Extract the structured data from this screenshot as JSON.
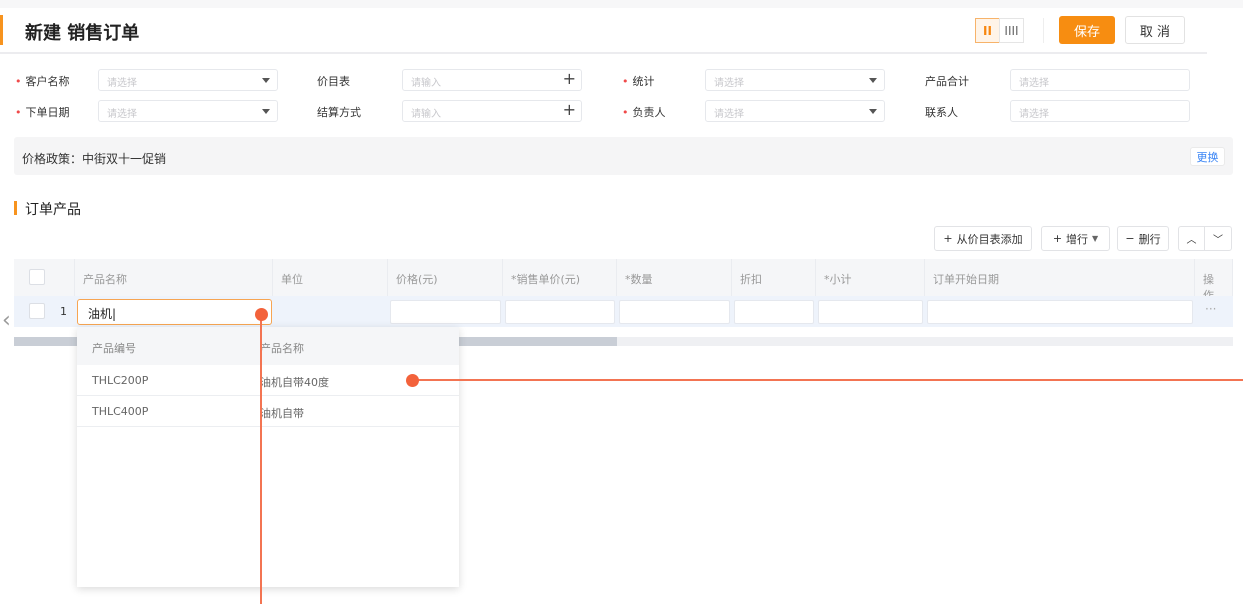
{
  "header": {
    "title": "新建 销售订单",
    "save_label": "保存",
    "cancel_label": "取 消",
    "view_toggle": [
      "II",
      "IIII"
    ]
  },
  "form": {
    "fields": [
      {
        "label": "客户名称",
        "required": true,
        "placeholder": "请选择",
        "type": "select"
      },
      {
        "label": "价目表",
        "required": false,
        "placeholder": "请输入",
        "type": "add"
      },
      {
        "label": "统计",
        "required": true,
        "placeholder": "请选择",
        "type": "select"
      },
      {
        "label": "产品合计",
        "required": false,
        "placeholder": "请选择",
        "type": "text"
      },
      {
        "label": "下单日期",
        "required": true,
        "placeholder": "请选择",
        "type": "select"
      },
      {
        "label": "结算方式",
        "required": false,
        "placeholder": "请输入",
        "type": "add"
      },
      {
        "label": "负责人",
        "required": true,
        "placeholder": "请选择",
        "type": "select"
      },
      {
        "label": "联系人",
        "required": false,
        "placeholder": "请选择",
        "type": "text"
      }
    ]
  },
  "policy": {
    "text": "价格政策：中街双十一促销",
    "change_label": "更换"
  },
  "section": {
    "title": "订单产品"
  },
  "toolbar": {
    "add_from_price": "从价目表添加",
    "add_row": "增行",
    "del_row": "删行"
  },
  "table": {
    "columns": [
      "产品名称",
      "单位",
      "价格(元)",
      "*销售单价(元)",
      "*数量",
      "折扣",
      "*小计",
      "订单开始日期",
      "操作"
    ],
    "rows": [
      {
        "index": "1",
        "product": "油机|",
        "actions": "···"
      }
    ]
  },
  "dropdown": {
    "columns": [
      "产品编号",
      "产品名称"
    ],
    "rows": [
      [
        "THLC200P",
        "油机自带40度"
      ],
      [
        "THLC400P",
        "油机自带"
      ]
    ]
  },
  "colors": {
    "accent": "#f78d11",
    "annotation": "#f3623b",
    "link": "#3a85f5"
  }
}
